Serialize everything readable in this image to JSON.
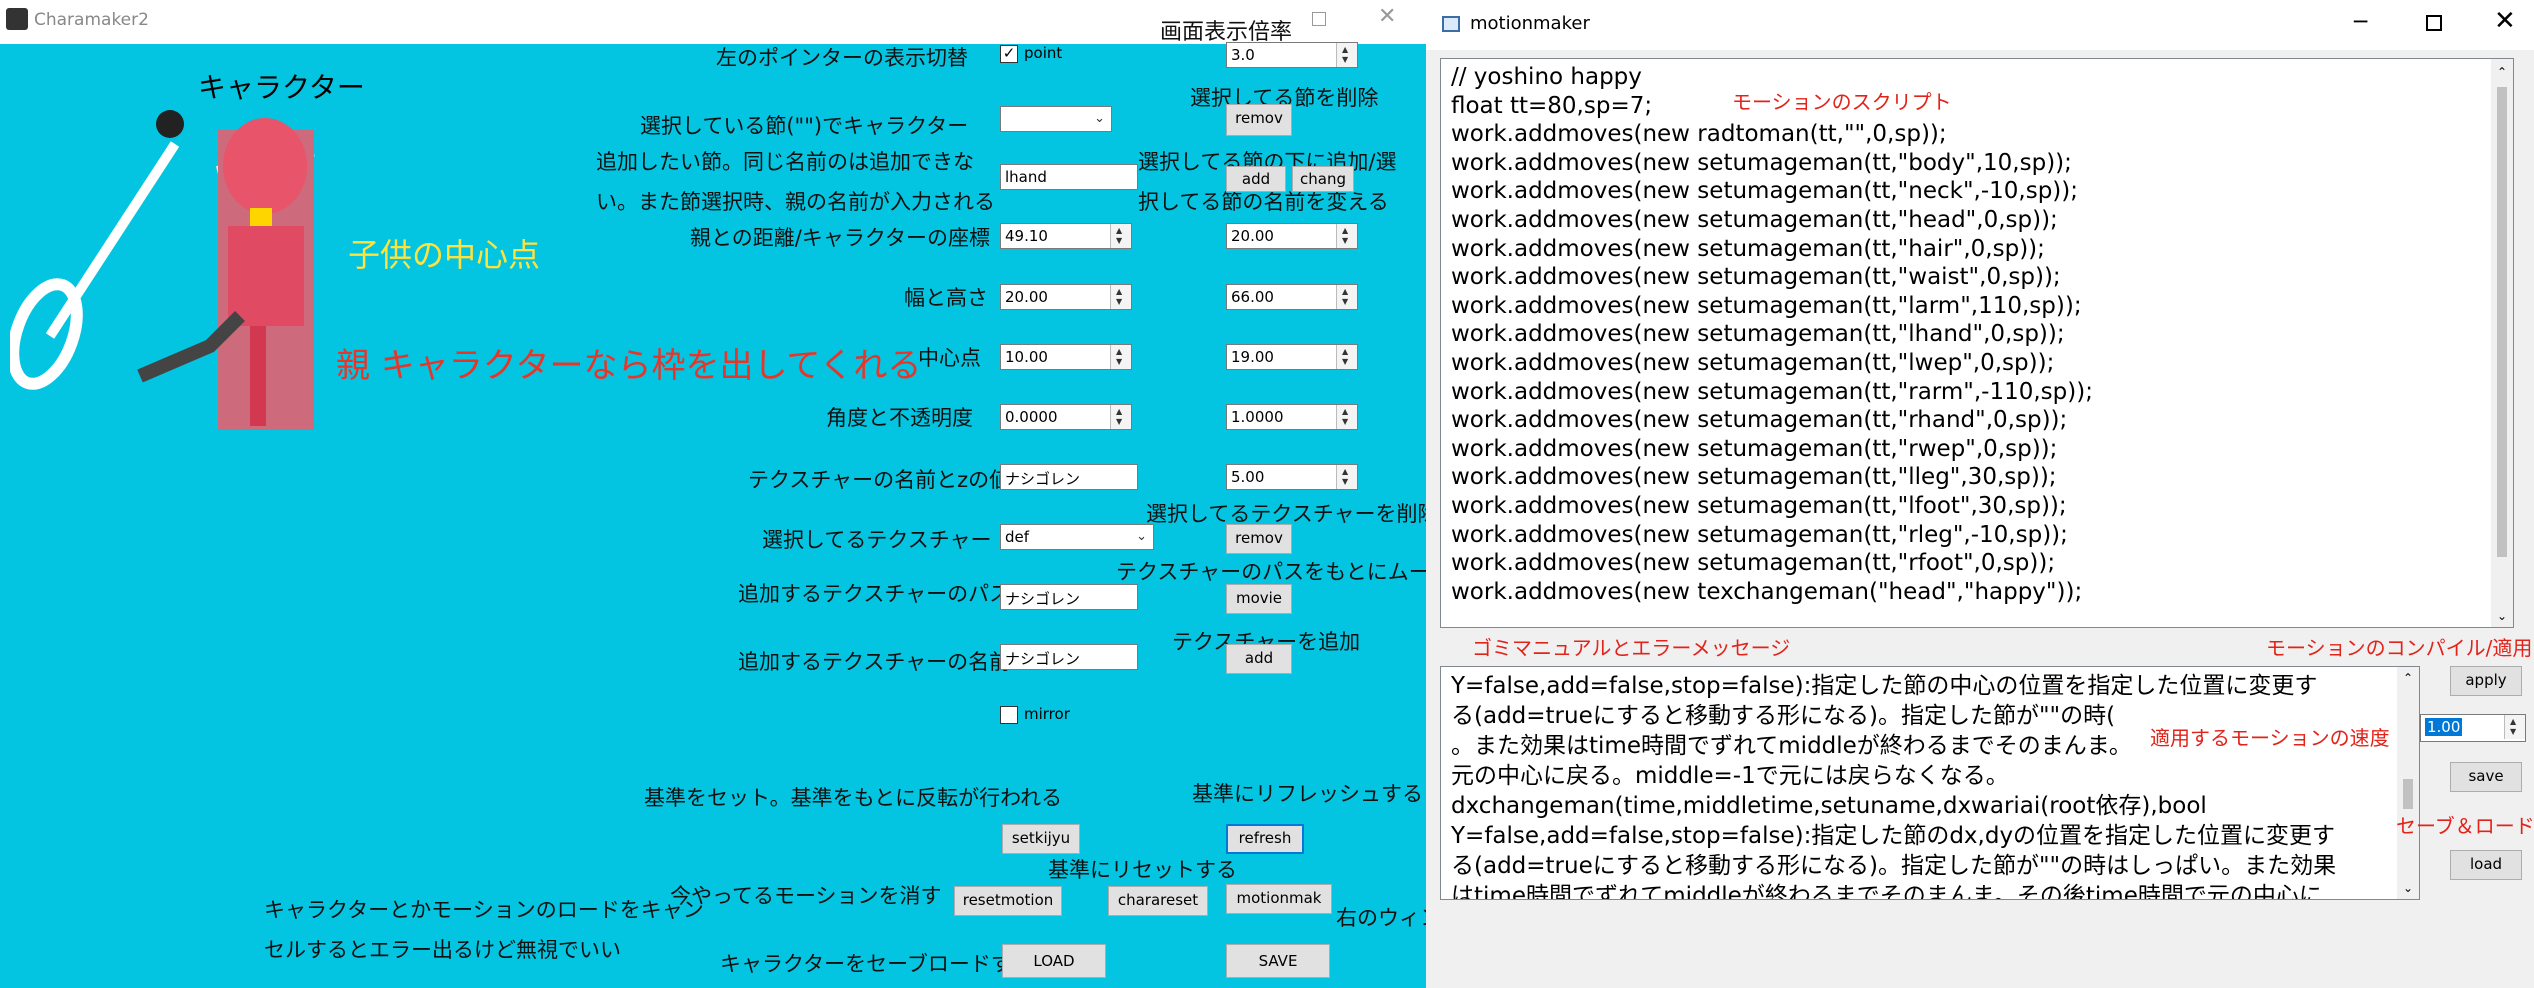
{
  "charamaker": {
    "title": "Charamaker2",
    "header_label": "画面表示倍率",
    "char_label": "キャラクター",
    "overlay_child": "子供の中心点",
    "overlay_parent": "親 キャラクターなら枠を出してくれる",
    "labels": {
      "pointer_toggle": "左のポインターの表示切替",
      "selected_joint": "選択している節(\"\")でキャラクター",
      "add_joint_1": "追加したい節。同じ名前のは追加できな",
      "add_joint_2": "い。また節選択時、親の名前が入力される",
      "distance": "親との距離/キャラクターの座標",
      "size": "幅と高さ",
      "center": "中心点",
      "angle_opacity": "角度と不透明度",
      "texture_name_z": "テクスチャーの名前とzの値",
      "selected_texture": "選択してるテクスチャー",
      "add_texture_path": "追加するテクスチャーのパス",
      "add_texture_name": "追加するテクスチャーの名前",
      "delete_joint": "選択してる節を削除",
      "add_under_1": "選択してる節の下に追加/選",
      "add_under_2": "択してる節の名前を変える",
      "delete_texture": "選択してるテクスチャーを削除",
      "movie_hint": "テクスチャーのパスをもとにムービー(使うな)",
      "add_texture": "テクスチャーを追加",
      "set_base": "基準をセット。基準をもとに反転が行われる",
      "refresh_base": "基準にリフレッシュする",
      "reset_base": "基準にリセットする",
      "clear_motion": "今やってるモーションを消す",
      "cancel_note_1": "キャラクターとかモーションのロードをキャン",
      "cancel_note_2": "セルするとエラー出るけど無視でいい",
      "save_load_char": "キャラクターをセーブロードする",
      "call_window": "右のウィンドウを呼び出す"
    },
    "fields": {
      "zoom": "3.0",
      "point_check": "point",
      "joint_name": "lhand",
      "dist_a": "49.10",
      "dist_b": "20.00",
      "width": "20.00",
      "height": "66.00",
      "center_x": "10.00",
      "center_y": "19.00",
      "angle": "0.0000",
      "opacity": "1.0000",
      "tex_name": "ナシゴレン",
      "z_value": "5.00",
      "tex_selected": "def",
      "tex_path": "ナシゴレン",
      "tex_add_name": "ナシゴレン",
      "mirror": "mirror"
    },
    "buttons": {
      "remov1": "remov",
      "add": "add",
      "change": "chang",
      "remov2": "remov",
      "movie": "movie",
      "add2": "add",
      "setkijyu": "setkijyu",
      "refresh": "refresh",
      "resetmotion": "resetmotion",
      "charareset": "charareset",
      "motionmak": "motionmak",
      "load": "LOAD",
      "save": "SAVE"
    }
  },
  "motionmaker": {
    "title": "motionmaker",
    "script_label": "モーションのスクリプト",
    "manual_label": "ゴミマニュアルとエラーメッセージ",
    "compile_label": "モーションのコンパイル/適用",
    "speed_label": "適用するモーションの速度",
    "saveload_label": "セーブ＆ロード",
    "speed_value": "1.00",
    "buttons": {
      "apply": "apply",
      "save": "save",
      "load": "load"
    },
    "code": [
      "// yoshino happy",
      "float tt=80,sp=7;",
      "work.addmoves(new radtoman(tt,\"\",0,sp));",
      "work.addmoves(new setumageman(tt,\"body\",10,sp));",
      "work.addmoves(new setumageman(tt,\"neck\",-10,sp));",
      "work.addmoves(new setumageman(tt,\"head\",0,sp));",
      "work.addmoves(new setumageman(tt,\"hair\",0,sp));",
      "work.addmoves(new setumageman(tt,\"waist\",0,sp));",
      "work.addmoves(new setumageman(tt,\"larm\",110,sp));",
      "work.addmoves(new setumageman(tt,\"lhand\",0,sp));",
      "work.addmoves(new setumageman(tt,\"lwep\",0,sp));",
      "work.addmoves(new setumageman(tt,\"rarm\",-110,sp));",
      "work.addmoves(new setumageman(tt,\"rhand\",0,sp));",
      "work.addmoves(new setumageman(tt,\"rwep\",0,sp));",
      "work.addmoves(new setumageman(tt,\"lleg\",30,sp));",
      "work.addmoves(new setumageman(tt,\"lfoot\",30,sp));",
      "work.addmoves(new setumageman(tt,\"rleg\",-10,sp));",
      "work.addmoves(new setumageman(tt,\"rfoot\",0,sp));",
      "work.addmoves(new texchangeman(\"head\",\"happy\"));"
    ],
    "manual": [
      "Y=false,add=false,stop=false):指定した節の中心の位置を指定した位置に変更す",
      "る(add=trueにすると移動する形になる)。指定した節が\"\"の時(",
      "。また効果はtime時間でずれてmiddleが終わるまでそのまんま。",
      "元の中心に戻る。middle=-1で元には戻らなくなる。",
      "dxchangeman(time,middletime,setuname,dxwariai(root依存),bool",
      "Y=false,add=false,stop=false):指定した節のdx,dyの位置を指定した位置に変更す",
      "る(add=trueにすると移動する形になる)。指定した節が\"\"の時はしっぱい。また効果",
      "はtime時間でずれてmiddleが終わるまでそのまんま。その後time時間で元の中心に"
    ]
  }
}
